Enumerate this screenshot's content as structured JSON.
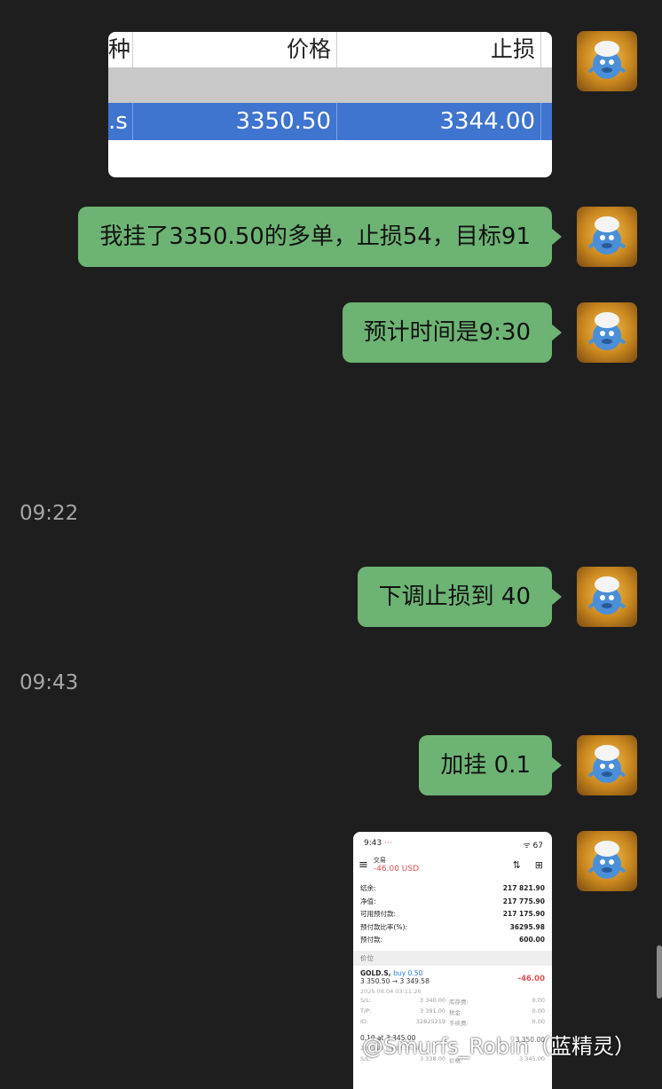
{
  "table_image": {
    "headers": [
      "种",
      "价格",
      "止损"
    ],
    "selected_row": [
      ".s",
      "3350.50",
      "3344.00"
    ]
  },
  "messages": [
    {
      "text": "我挂了3350.50的多单，止损54，目标91"
    },
    {
      "text": "预计时间是9:30"
    },
    {
      "text": "下调止损到 40"
    },
    {
      "text": "加挂 0.1"
    }
  ],
  "timestamps": [
    "09:22",
    "09:43"
  ],
  "phone_screenshot": {
    "time": "9:43",
    "dots": "···",
    "status_right": "ᯤ 67",
    "title": "交易",
    "pnl": "-46.00 USD",
    "rows": [
      {
        "label": "结余:",
        "value": "217 821.90"
      },
      {
        "label": "净值:",
        "value": "217 775.90"
      },
      {
        "label": "可用预付款:",
        "value": "217 175.90"
      },
      {
        "label": "预付款比率(%):",
        "value": "36295.98"
      },
      {
        "label": "预付款:",
        "value": "600.00"
      }
    ],
    "section": "价位",
    "position": {
      "symbol": "GOLD.S,",
      "side": "buy 0.50",
      "prices": "3 350.50 → 3 349.58",
      "pl": "-46.00",
      "datetime": "2025.08.04 03:11:26",
      "details": [
        {
          "k": "S/L:",
          "v": "3 340.00",
          "k2": "库存费:",
          "v2": "0.00"
        },
        {
          "k": "T/P:",
          "v": "3 391.00",
          "k2": "税金:",
          "v2": "0.00"
        },
        {
          "k": "ID:",
          "v": "32825219",
          "k2": "手续费:",
          "v2": "0.00"
        }
      ]
    },
    "order2": {
      "line": "0.10 at 3 345.00",
      "right": "3 350.00",
      "datetime": "2025.08.04 03:36:48",
      "sl_label": "S/L:",
      "sl": "3 338.00",
      "k2": "价格:",
      "v2": "3 345.00"
    }
  },
  "watermark": "@Smurfs_Robin（蓝精灵）",
  "colors": {
    "background": "#1e1e1e",
    "bubble": "#6db474",
    "selected_row": "#3f74cf",
    "loss": "#d9534f"
  },
  "icons": {
    "avatar": "smurf-avatar",
    "menu": "hamburger-icon",
    "sort": "sort-arrows-icon",
    "add": "new-order-icon"
  }
}
